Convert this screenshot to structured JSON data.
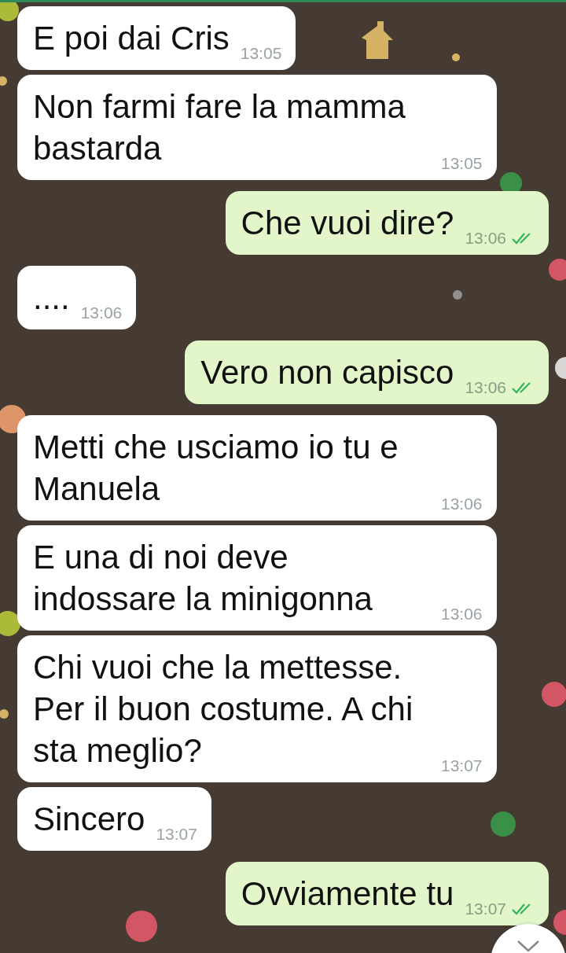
{
  "messages": [
    {
      "kind": "incoming",
      "text": "E poi dai Cris",
      "time": "13:05"
    },
    {
      "kind": "incoming",
      "text": "Non farmi fare la mamma bastarda",
      "time": "13:05"
    },
    {
      "kind": "outgoing",
      "text": "Che vuoi dire?",
      "time": "13:06",
      "read": true
    },
    {
      "kind": "incoming",
      "text": "....",
      "time": "13:06"
    },
    {
      "kind": "outgoing",
      "text": "Vero non capisco",
      "time": "13:06",
      "read": true
    },
    {
      "kind": "incoming",
      "text": "Metti che usciamo io tu e Manuela",
      "time": "13:06"
    },
    {
      "kind": "incoming",
      "text": "E una di noi deve indossare la minigonna",
      "time": "13:06"
    },
    {
      "kind": "incoming",
      "text": "Chi vuoi che la mettesse. Per il buon costume. A chi sta meglio?",
      "time": "13:07"
    },
    {
      "kind": "incoming",
      "text": "Sincero",
      "time": "13:07"
    },
    {
      "kind": "outgoing",
      "text": "Ovviamente tu",
      "time": "13:07",
      "read": true
    }
  ]
}
